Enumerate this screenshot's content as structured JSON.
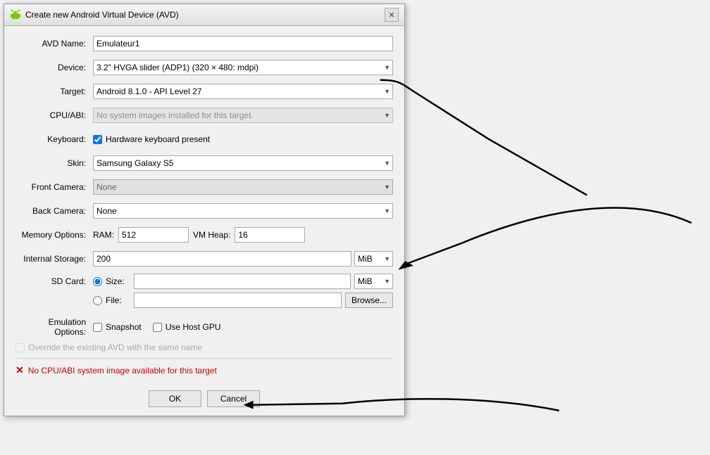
{
  "window": {
    "title": "Create new Android Virtual Device (AVD)",
    "close_label": "✕"
  },
  "fields": {
    "avd_name_label": "AVD Name:",
    "avd_name_value": "Emulateur1",
    "device_label": "Device:",
    "device_value": "3.2\" HVGA slider (ADP1) (320 × 480: mdpi)",
    "target_label": "Target:",
    "target_value": "Android 8.1.0 - API Level 27",
    "cpu_abi_label": "CPU/ABI:",
    "cpu_abi_value": "No system images installed for this target.",
    "keyboard_label": "Keyboard:",
    "keyboard_check_label": "Hardware keyboard present",
    "skin_label": "Skin:",
    "skin_value": "Samsung Galaxy S5",
    "front_camera_label": "Front Camera:",
    "front_camera_value": "None",
    "back_camera_label": "Back Camera:",
    "back_camera_value": "None",
    "memory_options_label": "Memory Options:",
    "ram_label": "RAM:",
    "ram_value": "512",
    "vm_heap_label": "VM Heap:",
    "vm_heap_value": "16",
    "internal_storage_label": "Internal Storage:",
    "internal_storage_value": "200",
    "internal_storage_unit": "MiB",
    "sd_card_label": "SD Card:",
    "size_label": "Size:",
    "size_unit": "MiB",
    "file_label": "File:",
    "browse_label": "Browse...",
    "emulation_options_label": "Emulation Options:",
    "snapshot_label": "Snapshot",
    "use_host_gpu_label": "Use Host GPU",
    "override_label": "Override the existing AVD with the same name",
    "error_text": "No CPU/ABI system image available for this target",
    "ok_label": "OK",
    "cancel_label": "Cancel"
  }
}
